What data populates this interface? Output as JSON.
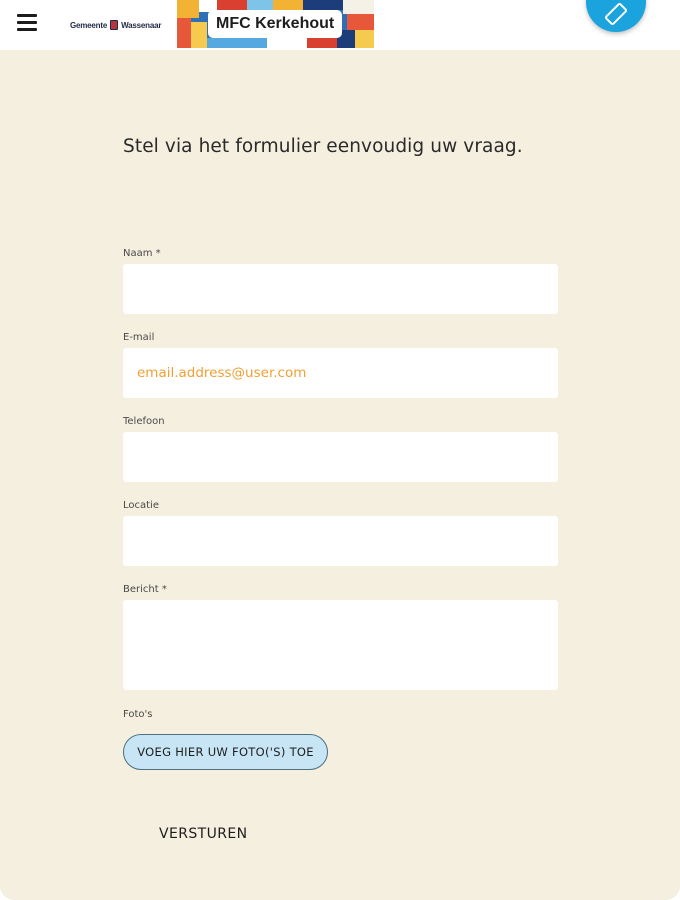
{
  "header": {
    "menu_icon": "hamburger-menu-icon",
    "logo_text_left": "Gemeente",
    "logo_text_right": "Wassenaar",
    "banner_title": "MFC Kerkehout",
    "fab_icon": "screen-rotate-icon",
    "accent_color": "#1aa3dc"
  },
  "form": {
    "intro": "Stel via het formulier eenvoudig uw vraag.",
    "fields": {
      "naam": {
        "label": "Naam *",
        "placeholder": ""
      },
      "email": {
        "label": "E-mail",
        "placeholder": "email.address@user.com"
      },
      "telefoon": {
        "label": "Telefoon",
        "placeholder": ""
      },
      "locatie": {
        "label": "Locatie",
        "placeholder": ""
      },
      "bericht": {
        "label": "Bericht *",
        "placeholder": ""
      }
    },
    "photos_label": "Foto's",
    "photos_button": "VOEG HIER UW FOTO('S) TOE",
    "submit_label": "VERSTUREN"
  },
  "colors": {
    "background": "#f4efdf",
    "field_background": "#ffffff",
    "placeholder": "#f0a035",
    "photo_button_bg": "#c7e5f4"
  }
}
